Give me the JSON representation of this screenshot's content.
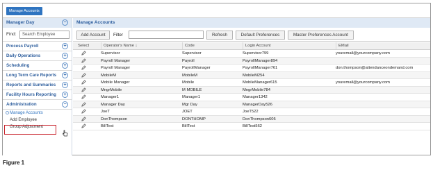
{
  "top_button": "Manage Accounts",
  "sidebar": {
    "title": "Manager Day",
    "find_label": "Find:",
    "find_placeholder": "Search Employee",
    "items": [
      {
        "label": "Process Payroll",
        "toggle": "+"
      },
      {
        "label": "Daily Operations",
        "toggle": "+"
      },
      {
        "label": "Scheduling",
        "toggle": "+"
      },
      {
        "label": "Long Term Care Reports",
        "toggle": "+"
      },
      {
        "label": "Reports and Summaries",
        "toggle": "+"
      },
      {
        "label": "Facility Hours Reporting",
        "toggle": "+"
      },
      {
        "label": "Administration",
        "toggle": "−"
      }
    ],
    "subitems": [
      "Manage Accounts",
      "Add Employee",
      "Group Adjustment"
    ],
    "title_toggle": "−"
  },
  "main": {
    "title": "Manage Accounts",
    "toolbar": {
      "add_account": "Add Account",
      "filter_label": "Filter",
      "refresh": "Refresh",
      "default_prefs": "Default Preferences",
      "master_prefs": "Master Preferences Account"
    },
    "columns": [
      "Select",
      "Operator's Name ↓",
      "Code",
      "Login Account",
      "EMail"
    ],
    "rows": [
      {
        "name": "Supervisor",
        "code": "Supervisor",
        "login": "Supervisor799",
        "email": "youremail@yourcompany.com"
      },
      {
        "name": "Payroll Manager",
        "code": "Payroll",
        "login": "PayrollManager894",
        "email": ""
      },
      {
        "name": "Payroll Manager",
        "code": "PayrollManager",
        "login": "PayrollManager761",
        "email": "don.thompson@attendanceondemand.com"
      },
      {
        "name": "MobileM",
        "code": "MobileM",
        "login": "MobileM254",
        "email": ""
      },
      {
        "name": "Mobile Manager",
        "code": "Mobile",
        "login": "MobileManager615",
        "email": "youremail@yourcompany.com"
      },
      {
        "name": "MngrMobile",
        "code": "M MOBILE",
        "login": "MngrMobile784",
        "email": ""
      },
      {
        "name": "Manager1",
        "code": "Manager1",
        "login": "Manager1342",
        "email": ""
      },
      {
        "name": "Manager Day",
        "code": "Mgr Day",
        "login": "ManagerDay526",
        "email": ""
      },
      {
        "name": "JoeT",
        "code": "JOET",
        "login": "JoeT522",
        "email": ""
      },
      {
        "name": "DonThompson",
        "code": "DONTHOMP",
        "login": "DonThompson605",
        "email": ""
      },
      {
        "name": "BillTest",
        "code": "BillTest",
        "login": "BillTest562",
        "email": ""
      }
    ]
  },
  "caption": "Figure 1",
  "colors": {
    "accent": "#2f74c0",
    "header_bg": "#dfe9f5",
    "highlight": "#c8232c"
  },
  "icons": [
    "collapse-circle-icon",
    "expand-circle-icon",
    "edit-pencil-icon",
    "hand-cursor-icon",
    "sort-arrow-icon"
  ]
}
